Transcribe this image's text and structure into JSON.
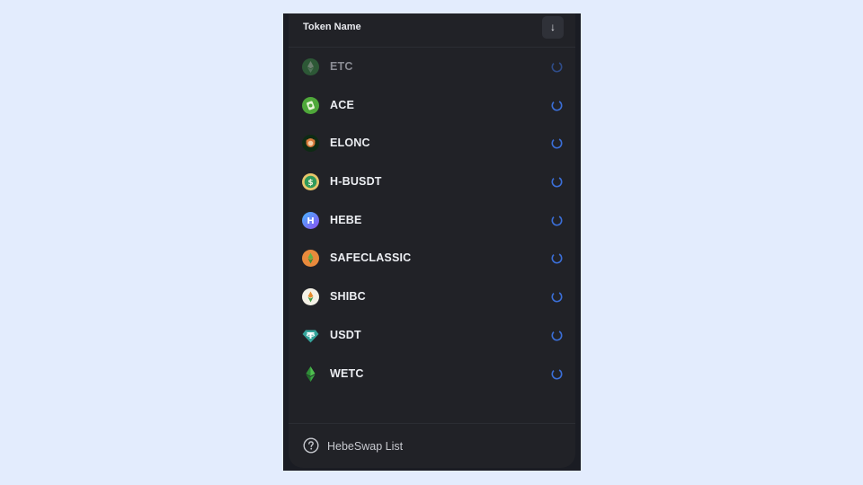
{
  "header": {
    "title": "Token Name",
    "sort_icon": "arrow-down-icon",
    "sort_glyph": "↓"
  },
  "tokens": [
    {
      "symbol": "ETC",
      "icon": "etc-logo-icon",
      "status": "loading",
      "dimmed": true
    },
    {
      "symbol": "ACE",
      "icon": "ace-logo-icon",
      "status": "loading"
    },
    {
      "symbol": "ELONC",
      "icon": "elonc-logo-icon",
      "status": "loading"
    },
    {
      "symbol": "H-BUSDT",
      "icon": "h-busdt-logo-icon",
      "status": "loading"
    },
    {
      "symbol": "HEBE",
      "icon": "hebe-logo-icon",
      "status": "loading"
    },
    {
      "symbol": "SAFECLASSIC",
      "icon": "safeclassic-logo-icon",
      "status": "loading"
    },
    {
      "symbol": "SHIBC",
      "icon": "shibc-logo-icon",
      "status": "loading"
    },
    {
      "symbol": "USDT",
      "icon": "usdt-logo-icon",
      "status": "loading"
    },
    {
      "symbol": "WETC",
      "icon": "wetc-logo-icon",
      "status": "loading"
    }
  ],
  "footer": {
    "label": "HebeSwap List",
    "icon": "question-circle-icon"
  },
  "colors": {
    "page_background": "#e3ecfd",
    "panel_background": "#212227",
    "spinner_accent": "#3b6fd8"
  }
}
